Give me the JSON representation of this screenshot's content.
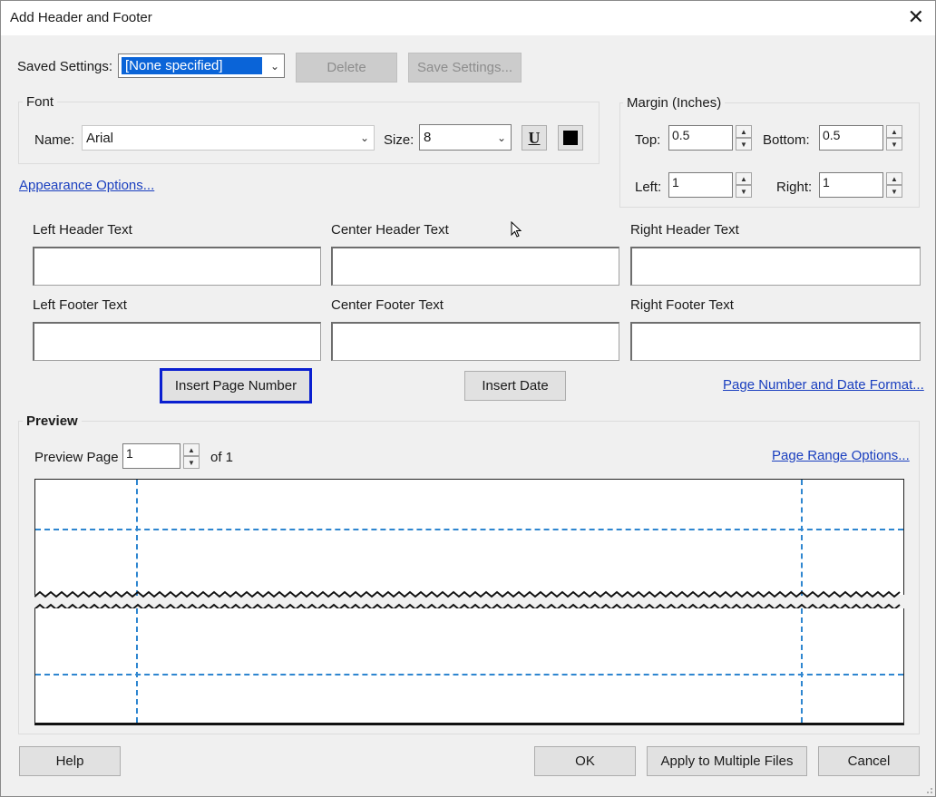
{
  "window": {
    "title": "Add Header and Footer"
  },
  "saved_settings": {
    "label": "Saved Settings:",
    "value": "[None specified]",
    "delete_label": "Delete",
    "save_label": "Save Settings..."
  },
  "font": {
    "group_title": "Font",
    "name_label": "Name:",
    "name_value": "Arial",
    "size_label": "Size:",
    "size_value": "8"
  },
  "appearance_link": "Appearance Options...",
  "margin": {
    "group_title": "Margin (Inches)",
    "top_label": "Top:",
    "top_value": "0.5",
    "bottom_label": "Bottom:",
    "bottom_value": "0.5",
    "left_label": "Left:",
    "left_value": "1",
    "right_label": "Right:",
    "right_value": "1"
  },
  "text_fields": {
    "left_header": "Left Header Text",
    "center_header": "Center Header Text",
    "right_header": "Right Header Text",
    "left_footer": "Left Footer Text",
    "center_footer": "Center Footer Text",
    "right_footer": "Right Footer Text"
  },
  "insert_page_number": "Insert Page Number",
  "insert_date": "Insert Date",
  "page_number_date_link": "Page Number and Date Format...",
  "preview": {
    "title": "Preview",
    "page_label": "Preview Page",
    "page_value": "1",
    "of_label": "of 1",
    "range_link": "Page Range Options..."
  },
  "buttons": {
    "help": "Help",
    "ok": "OK",
    "apply_multiple": "Apply to Multiple Files",
    "cancel": "Cancel"
  },
  "colors": {
    "selection": "#0a64d8",
    "focus_border": "#0a1fd0",
    "guide": "#2e86d0",
    "link": "#1a3fbf"
  }
}
